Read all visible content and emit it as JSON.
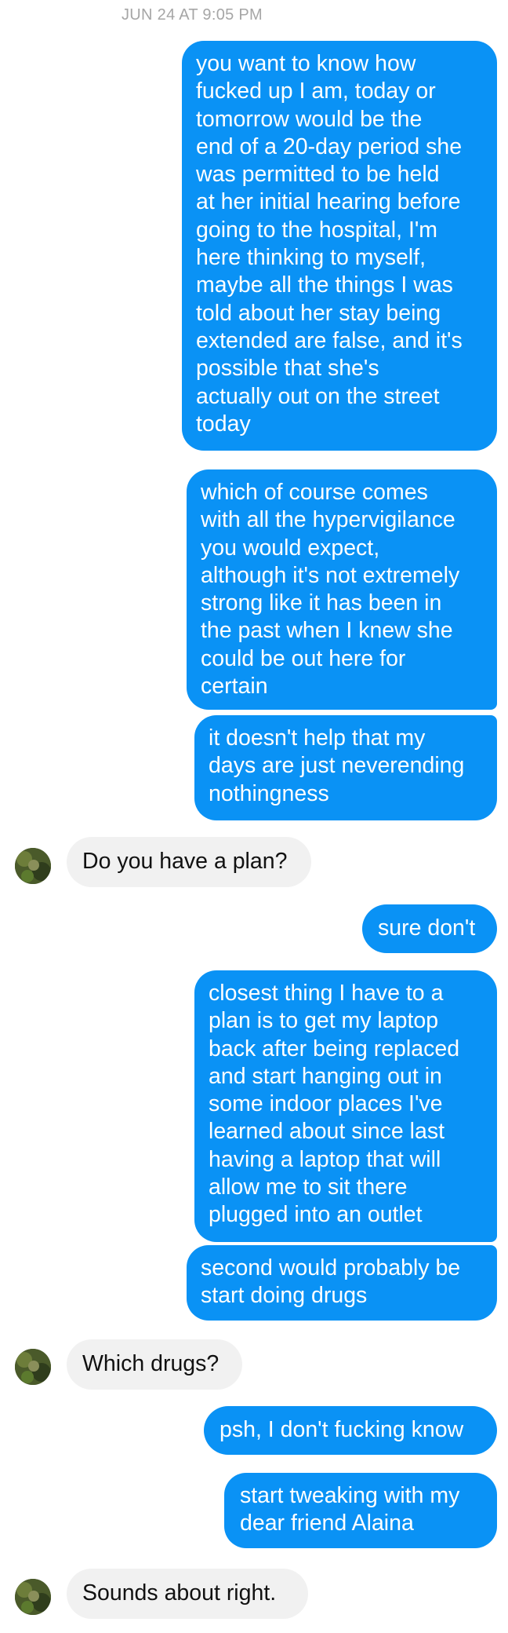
{
  "conversation": {
    "timestamp": "JUN 24 AT 9:05 PM",
    "messages": [
      {
        "side": "sent",
        "text": "you want to know how\nfucked up I am, today or\ntomorrow would be the\nend of a 20-day period she\nwas permitted to be held\nat her initial hearing before\ngoing to the hospital, I'm\nhere thinking to myself,\nmaybe all the things I was\ntold about her stay being\nextended are false, and it's\npossible that she's\nactually out on the street\ntoday"
      },
      {
        "side": "sent",
        "text": "which of course comes\nwith all the hypervigilance\nyou would expect,\nalthough it's not extremely\nstrong like it has been in\nthe past when I knew she\ncould be out here for\ncertain"
      },
      {
        "side": "sent",
        "text": "it doesn't help that my\ndays are just neverending\nnothingness"
      },
      {
        "side": "received",
        "text": "Do you have a plan?"
      },
      {
        "side": "sent",
        "text": "sure don't"
      },
      {
        "side": "sent",
        "text": "closest thing I have to a\nplan is to get my laptop\nback after being replaced\nand start hanging out in\nsome indoor places I've\nlearned about since last\nhaving a laptop that will\nallow me to sit there\nplugged into an outlet"
      },
      {
        "side": "sent",
        "text": "second would probably be\nstart doing drugs"
      },
      {
        "side": "received",
        "text": "Which drugs?"
      },
      {
        "side": "sent",
        "text": "psh, I don't fucking know"
      },
      {
        "side": "sent",
        "text": "start tweaking with my\ndear friend Alaina"
      },
      {
        "side": "received",
        "text": "Sounds about right."
      }
    ]
  },
  "colors": {
    "sent_bubble": "#0a92f5",
    "sent_text": "#ffffff",
    "received_bubble": "#f1f1f1",
    "received_text": "#111111",
    "timestamp_text": "#a6a6a6",
    "background": "#ffffff"
  },
  "icons": {
    "contact_avatar": "contact-avatar-photo"
  }
}
